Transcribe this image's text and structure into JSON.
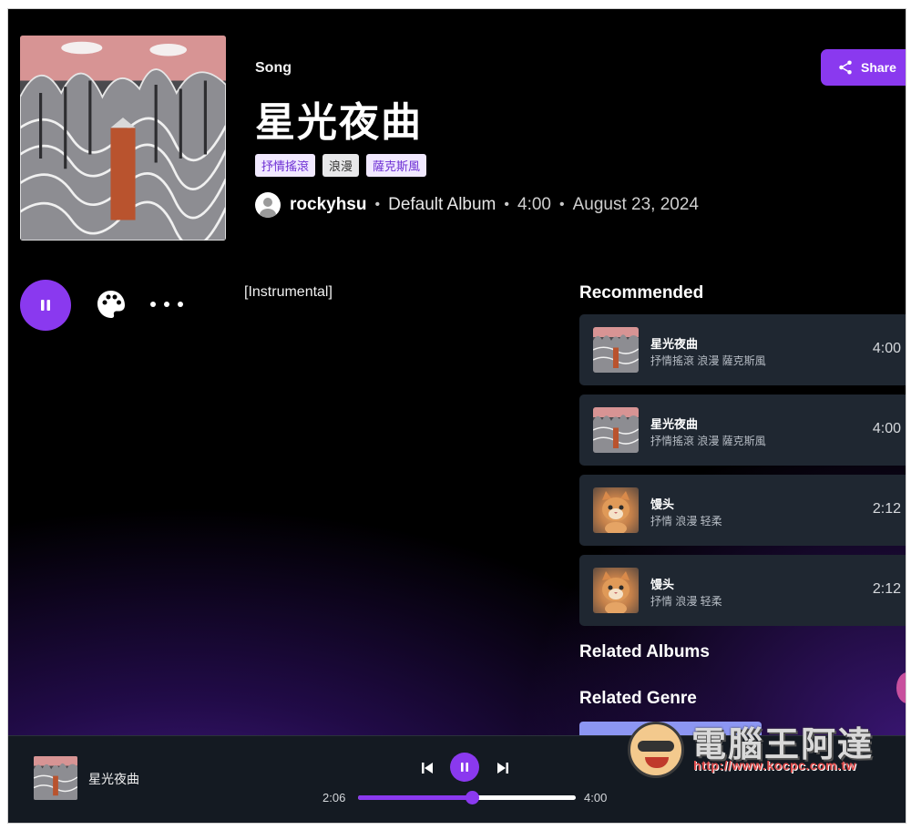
{
  "header": {
    "type_label": "Song",
    "title": "星光夜曲",
    "tags": [
      "抒情搖滾",
      "浪漫",
      "薩克斯風"
    ],
    "artist": "rockyhsu",
    "album": "Default Album",
    "duration": "4:00",
    "date": "August 23, 2024",
    "share_label": "Share"
  },
  "actions": {
    "play_state": "pause-icon",
    "palette_icon": "palette-icon",
    "more_icon": "more-icon"
  },
  "lyrics": {
    "text": "[Instrumental]"
  },
  "recommended": {
    "heading": "Recommended",
    "items": [
      {
        "title": "星光夜曲",
        "tags": "抒情搖滾 浪漫 薩克斯風",
        "duration": "4:00",
        "art": "mountain-art"
      },
      {
        "title": "星光夜曲",
        "tags": "抒情搖滾 浪漫 薩克斯風",
        "duration": "4:00",
        "art": "mountain-art"
      },
      {
        "title": "馒头",
        "tags": "抒情 浪漫 轻柔",
        "duration": "2:12",
        "art": "cat-art"
      },
      {
        "title": "馒头",
        "tags": "抒情 浪漫 轻柔",
        "duration": "2:12",
        "art": "cat-art"
      }
    ]
  },
  "related_albums": {
    "heading": "Related Albums"
  },
  "related_genre": {
    "heading": "Related Genre"
  },
  "player": {
    "title": "星光夜曲",
    "current_time": "2:06",
    "total_time": "4:00",
    "progress": 0.525
  },
  "watermark": {
    "text": "電腦王阿達",
    "url": "http://www.kocpc.com.tw"
  },
  "colors": {
    "accent": "#8a39ef",
    "card_bg": "#1f2731",
    "player_bg": "#141a22"
  }
}
